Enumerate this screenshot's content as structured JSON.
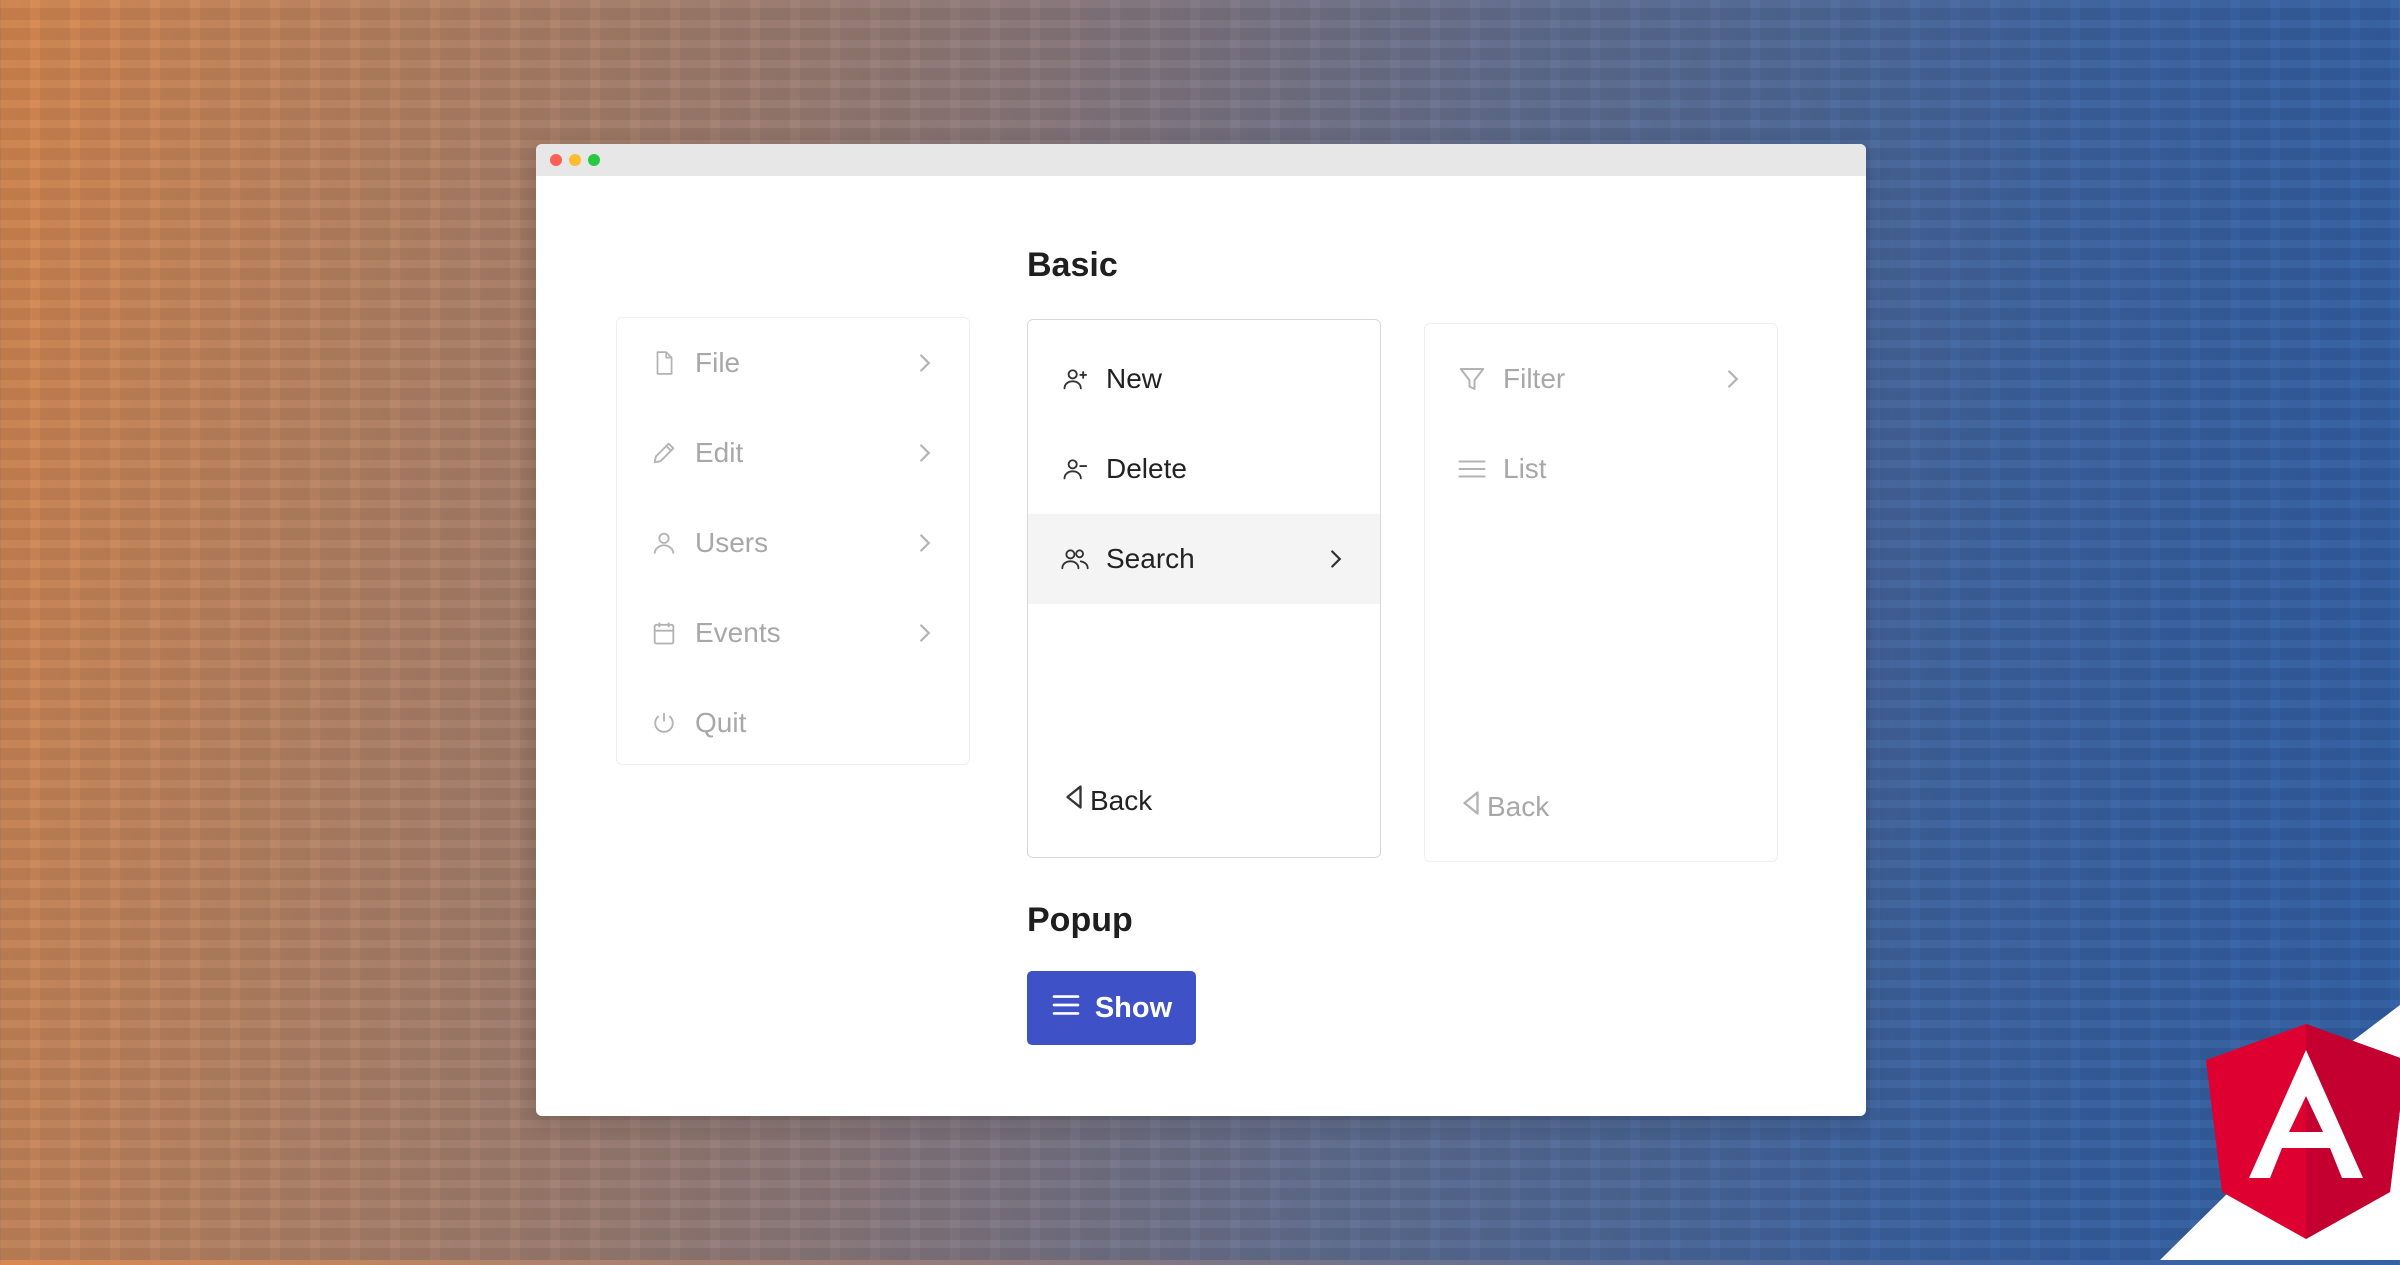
{
  "window": {
    "title": ""
  },
  "sections": {
    "basic_heading": "Basic",
    "popup_heading": "Popup"
  },
  "menu_level1": {
    "items": [
      {
        "label": "File",
        "icon": "file-icon",
        "has_submenu": true
      },
      {
        "label": "Edit",
        "icon": "pencil-icon",
        "has_submenu": true
      },
      {
        "label": "Users",
        "icon": "user-icon",
        "has_submenu": true
      },
      {
        "label": "Events",
        "icon": "calendar-icon",
        "has_submenu": true
      },
      {
        "label": "Quit",
        "icon": "power-icon",
        "has_submenu": false
      }
    ]
  },
  "menu_level2": {
    "items": [
      {
        "label": "New",
        "icon": "user-plus-icon",
        "has_submenu": false
      },
      {
        "label": "Delete",
        "icon": "user-minus-icon",
        "has_submenu": false
      },
      {
        "label": "Search",
        "icon": "users-icon",
        "has_submenu": true,
        "active": true
      }
    ],
    "back_label": "Back"
  },
  "menu_level3": {
    "items": [
      {
        "label": "Filter",
        "icon": "filter-icon",
        "has_submenu": true
      },
      {
        "label": "List",
        "icon": "list-icon",
        "has_submenu": false
      }
    ],
    "back_label": "Back"
  },
  "popup": {
    "button_label": "Show",
    "button_icon": "bars-icon"
  },
  "brand": {
    "logo": "angular-logo",
    "accent": "#3f51c6",
    "logo_color": "#dd0031"
  }
}
